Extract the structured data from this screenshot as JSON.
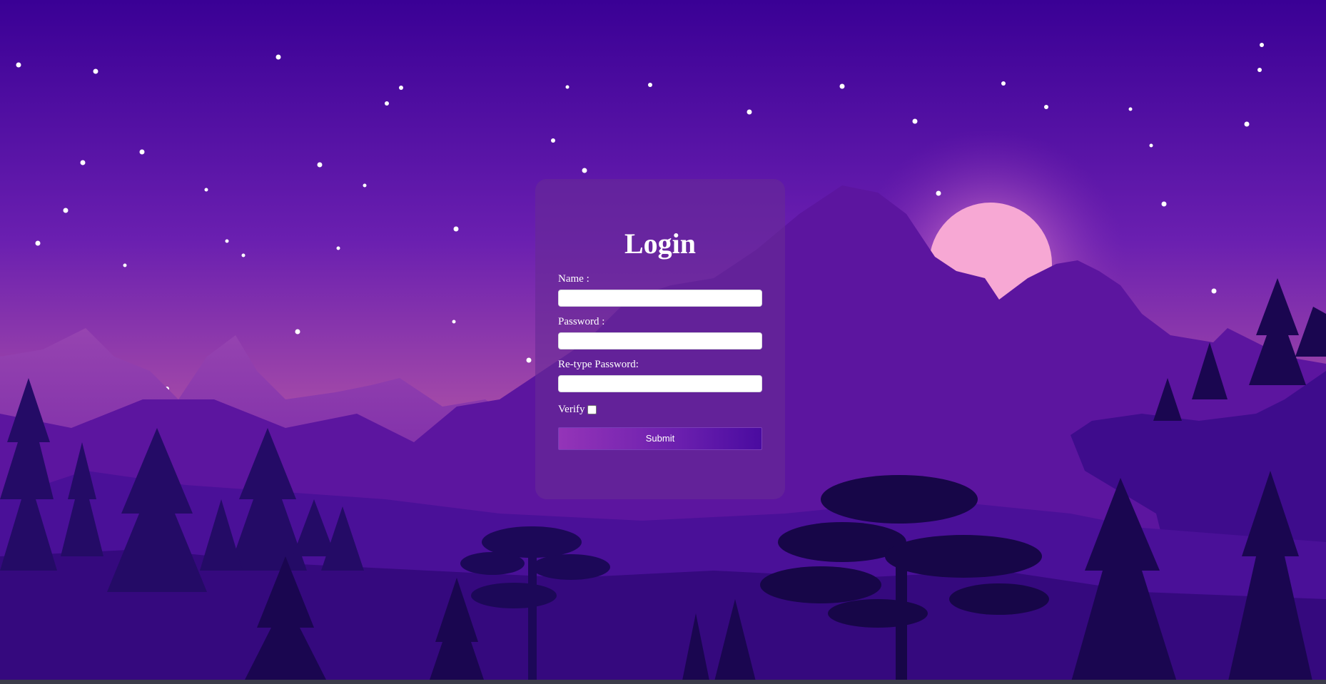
{
  "form": {
    "title": "Login",
    "fields": [
      {
        "label": "Name :",
        "value": "",
        "placeholder": ""
      },
      {
        "label": "Password :",
        "value": "",
        "placeholder": ""
      },
      {
        "label": "Re-type Password:",
        "value": "",
        "placeholder": ""
      }
    ],
    "verify_label": "Verify",
    "verify_checked": false,
    "submit_label": "Submit"
  },
  "background": {
    "theme": "night-mountain-landscape",
    "colors": {
      "sky_top": "#3a0095",
      "sky_bottom": "#b54aa8",
      "moon": "#f7a8d4",
      "far_mountains": "#8a3aa6",
      "mid_mountains": "#5c159f",
      "trees": "#1e0a5a"
    }
  }
}
